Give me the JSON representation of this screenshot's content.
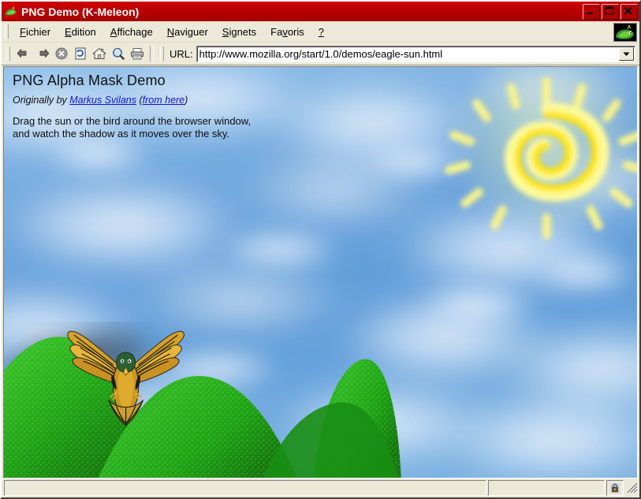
{
  "window": {
    "title": "PNG Demo (K-Meleon)",
    "title_icon": "kmeleon-lizard-icon",
    "titlebar_color": "#b50000",
    "controls": {
      "minimize": "Minimize",
      "maximize": "Maximize",
      "close": "Close"
    }
  },
  "menubar": {
    "items": [
      {
        "label": "Fichier",
        "pre": "F",
        "post": "ichier"
      },
      {
        "label": "Edition",
        "pre": "E",
        "post": "dition"
      },
      {
        "label": "Affichage",
        "pre": "A",
        "post": "ffichage"
      },
      {
        "label": "Naviguer",
        "pre": "N",
        "post": "aviguer"
      },
      {
        "label": "Signets",
        "pre": "S",
        "post": "ignets"
      },
      {
        "label": "Favoris",
        "pre": "Fa",
        "mid": "v",
        "post": "oris"
      },
      {
        "label": "?",
        "pre": "?",
        "post": ""
      }
    ],
    "logo": "kmeleon-logo-icon"
  },
  "toolbar": {
    "buttons": [
      {
        "name": "back-button",
        "icon": "arrow-left-icon",
        "label": "Back"
      },
      {
        "name": "forward-button",
        "icon": "arrow-right-icon",
        "label": "Forward"
      },
      {
        "name": "stop-button",
        "icon": "stop-icon",
        "label": "Stop"
      },
      {
        "name": "reload-button",
        "icon": "reload-icon",
        "label": "Reload"
      },
      {
        "name": "home-button",
        "icon": "home-icon",
        "label": "Home"
      },
      {
        "name": "search-button",
        "icon": "search-icon",
        "label": "Search"
      },
      {
        "name": "print-button",
        "icon": "print-icon",
        "label": "Print"
      }
    ],
    "url_label": "URL:",
    "url_value": "http://www.mozilla.org/start/1.0/demos/eagle-sun.html",
    "url_placeholder": "http://",
    "dropdown_icon": "chevron-down-icon"
  },
  "page": {
    "title": "PNG Alpha Mask Demo",
    "credit_prefix": "Originally by ",
    "credit_author": "Markus Svilans",
    "credit_open_paren": " (",
    "credit_link": "from here",
    "credit_close_paren": ")",
    "body_line1": "Drag the sun or the bird around the browser window,",
    "body_line2": "and watch the shadow as it moves over the sky.",
    "link_color": "#1414cf",
    "graphics": {
      "sky": "blue-sky-with-clouds",
      "sun": "yellow-spiral-sun-with-rays",
      "bird": "golden-eagle-wings-spread",
      "bird_shadow": "blurred-dark-shadow",
      "hills": "three-green-speckled-hills"
    },
    "sky_color": "#6ea8dd",
    "sun_color": "#fff176",
    "hill_color": "#2aab22"
  },
  "statusbar": {
    "main_text": "",
    "secondary_text": "",
    "security_icon": "security-lock-icon",
    "resize_grip": "resize-grip-icon"
  }
}
